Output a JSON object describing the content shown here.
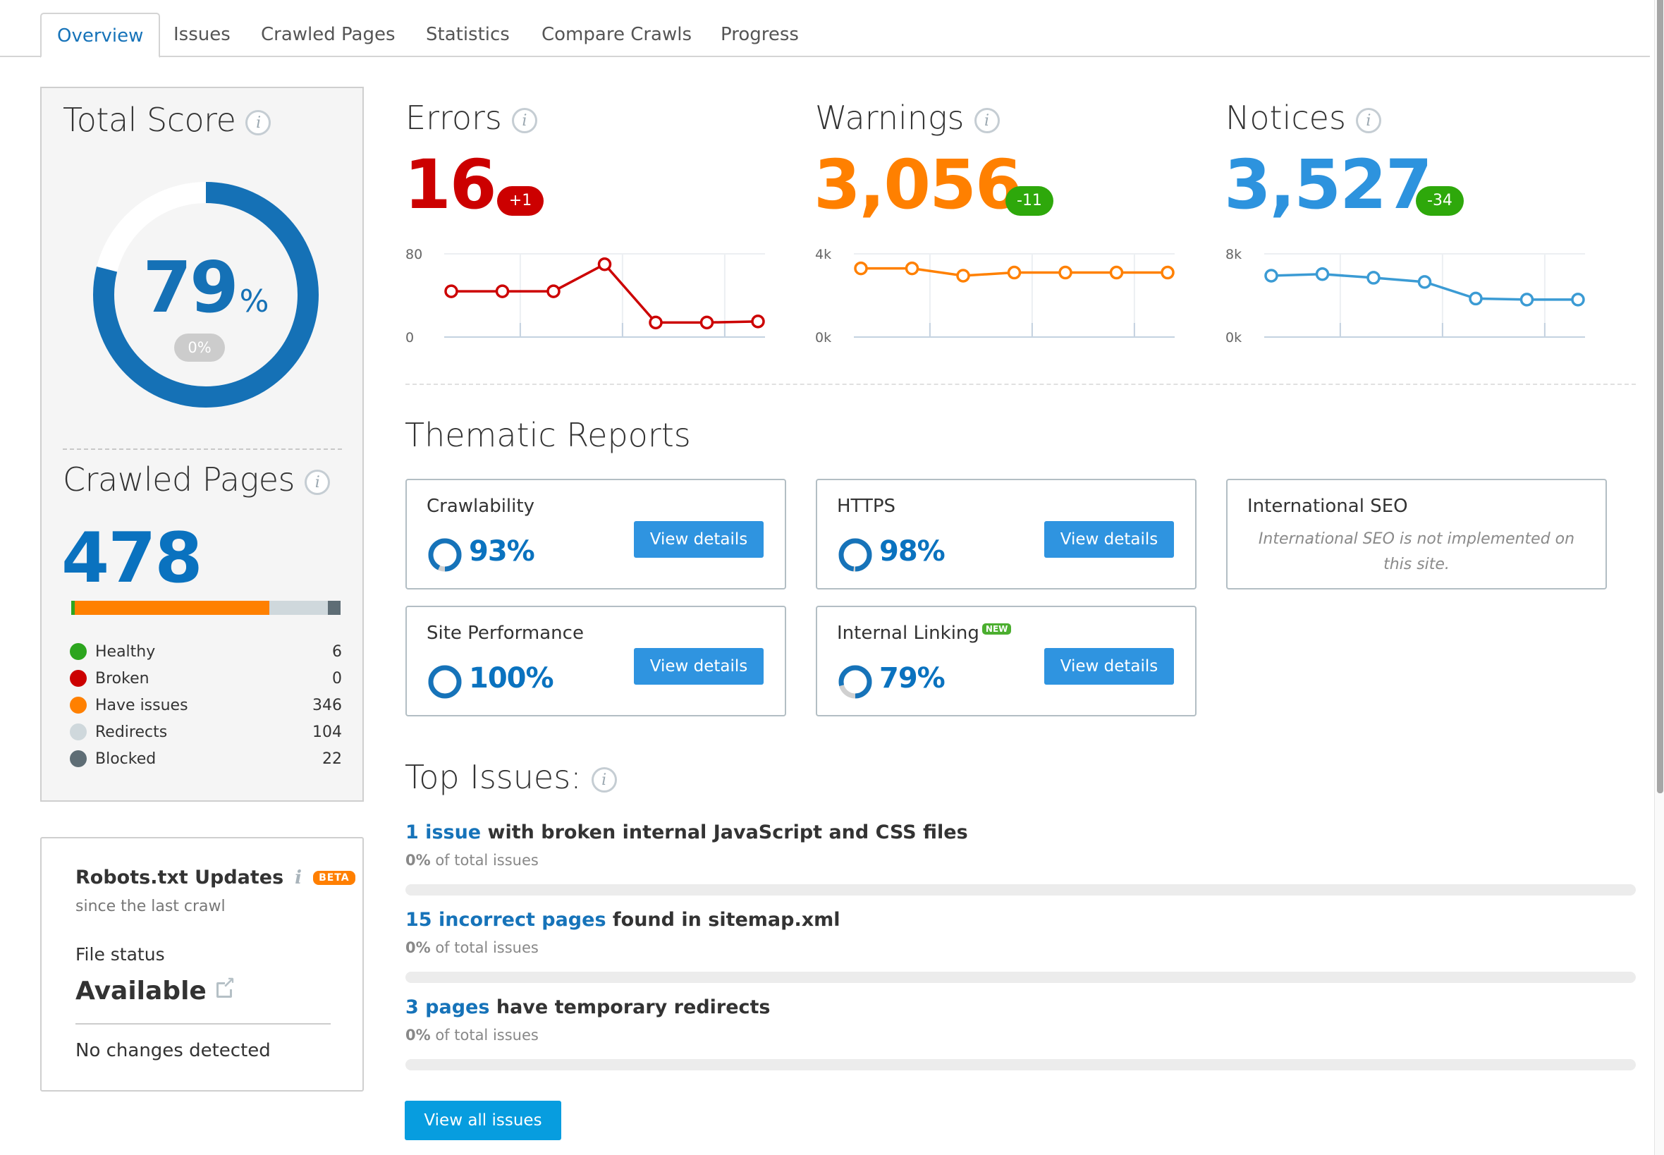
{
  "tabs": [
    {
      "label": "Overview",
      "active": true
    },
    {
      "label": "Issues",
      "active": false
    },
    {
      "label": "Crawled Pages",
      "active": false
    },
    {
      "label": "Statistics",
      "active": false
    },
    {
      "label": "Compare Crawls",
      "active": false
    },
    {
      "label": "Progress",
      "active": false
    }
  ],
  "total_score": {
    "title": "Total Score",
    "value": "79",
    "unit": "%",
    "fraction": 0.79,
    "delta": "0%",
    "color": "#1571b6"
  },
  "crawled_pages": {
    "title": "Crawled Pages",
    "count": "478",
    "breakdown": [
      {
        "label": "Healthy",
        "value": 6,
        "color": "#2ca51e"
      },
      {
        "label": "Broken",
        "value": 0,
        "color": "#cc0000"
      },
      {
        "label": "Have issues",
        "value": 346,
        "color": "#ff8000"
      },
      {
        "label": "Redirects",
        "value": 104,
        "color": "#cfd8dc"
      },
      {
        "label": "Blocked",
        "value": 22,
        "color": "#5e6d75"
      }
    ]
  },
  "robots": {
    "title": "Robots.txt Updates",
    "info_glyph": "i",
    "badge": "BETA",
    "subtitle": "since the last crawl",
    "file_status_label": "File status",
    "file_status_value": "Available",
    "changes": "No changes detected"
  },
  "metrics": [
    {
      "title": "Errors",
      "value": "16",
      "delta": "+1",
      "color": "#cc0000",
      "badge_color": "#cc0000"
    },
    {
      "title": "Warnings",
      "value": "3,056",
      "delta": "-11",
      "color": "#ff8000",
      "badge_color": "#2ea80b"
    },
    {
      "title": "Notices",
      "value": "3,527",
      "delta": "-34",
      "color": "#2d93de",
      "badge_color": "#2ea80b"
    }
  ],
  "chart_data": [
    {
      "type": "line",
      "title": "Errors",
      "ylim": [
        0,
        80
      ],
      "yticks": [
        "0",
        "80"
      ],
      "values": [
        44,
        44,
        44,
        70,
        14,
        14,
        15
      ],
      "color": "#cc0000"
    },
    {
      "type": "line",
      "title": "Warnings",
      "ylim": [
        0,
        4000
      ],
      "yticks": [
        "0k",
        "4k"
      ],
      "values": [
        3300,
        3300,
        2950,
        3100,
        3100,
        3100,
        3100
      ],
      "color": "#ff8000"
    },
    {
      "type": "line",
      "title": "Notices",
      "ylim": [
        0,
        8000
      ],
      "yticks": [
        "0k",
        "8k"
      ],
      "values": [
        5900,
        6050,
        5700,
        5300,
        3700,
        3600,
        3600
      ],
      "color": "#3b9bd4"
    }
  ],
  "thematic": {
    "title": "Thematic Reports",
    "button_label": "View details",
    "cards": [
      {
        "name": "Crawlability",
        "percent": "93%",
        "fraction": 0.93,
        "has_button": true
      },
      {
        "name": "HTTPS",
        "percent": "98%",
        "fraction": 0.98,
        "has_button": true
      },
      {
        "name": "International SEO",
        "note": "International SEO is not implemented on this site."
      },
      {
        "name": "Site Performance",
        "percent": "100%",
        "fraction": 1.0,
        "has_button": true
      },
      {
        "name": "Internal Linking",
        "badge": "NEW",
        "percent": "79%",
        "fraction": 0.79,
        "has_button": true
      }
    ]
  },
  "top_issues": {
    "title": "Top Issues:",
    "items": [
      {
        "link": "1 issue",
        "text": " with broken internal JavaScript and CSS files",
        "share": "0%",
        "share_suffix": " of total issues",
        "fraction": 0
      },
      {
        "link": "15 incorrect pages",
        "text": " found in sitemap.xml",
        "share": "0%",
        "share_suffix": " of total issues",
        "fraction": 0
      },
      {
        "link": "3 pages",
        "text": " have temporary redirects",
        "share": "0%",
        "share_suffix": " of total issues",
        "fraction": 0
      }
    ],
    "view_all_label": "View all issues"
  }
}
